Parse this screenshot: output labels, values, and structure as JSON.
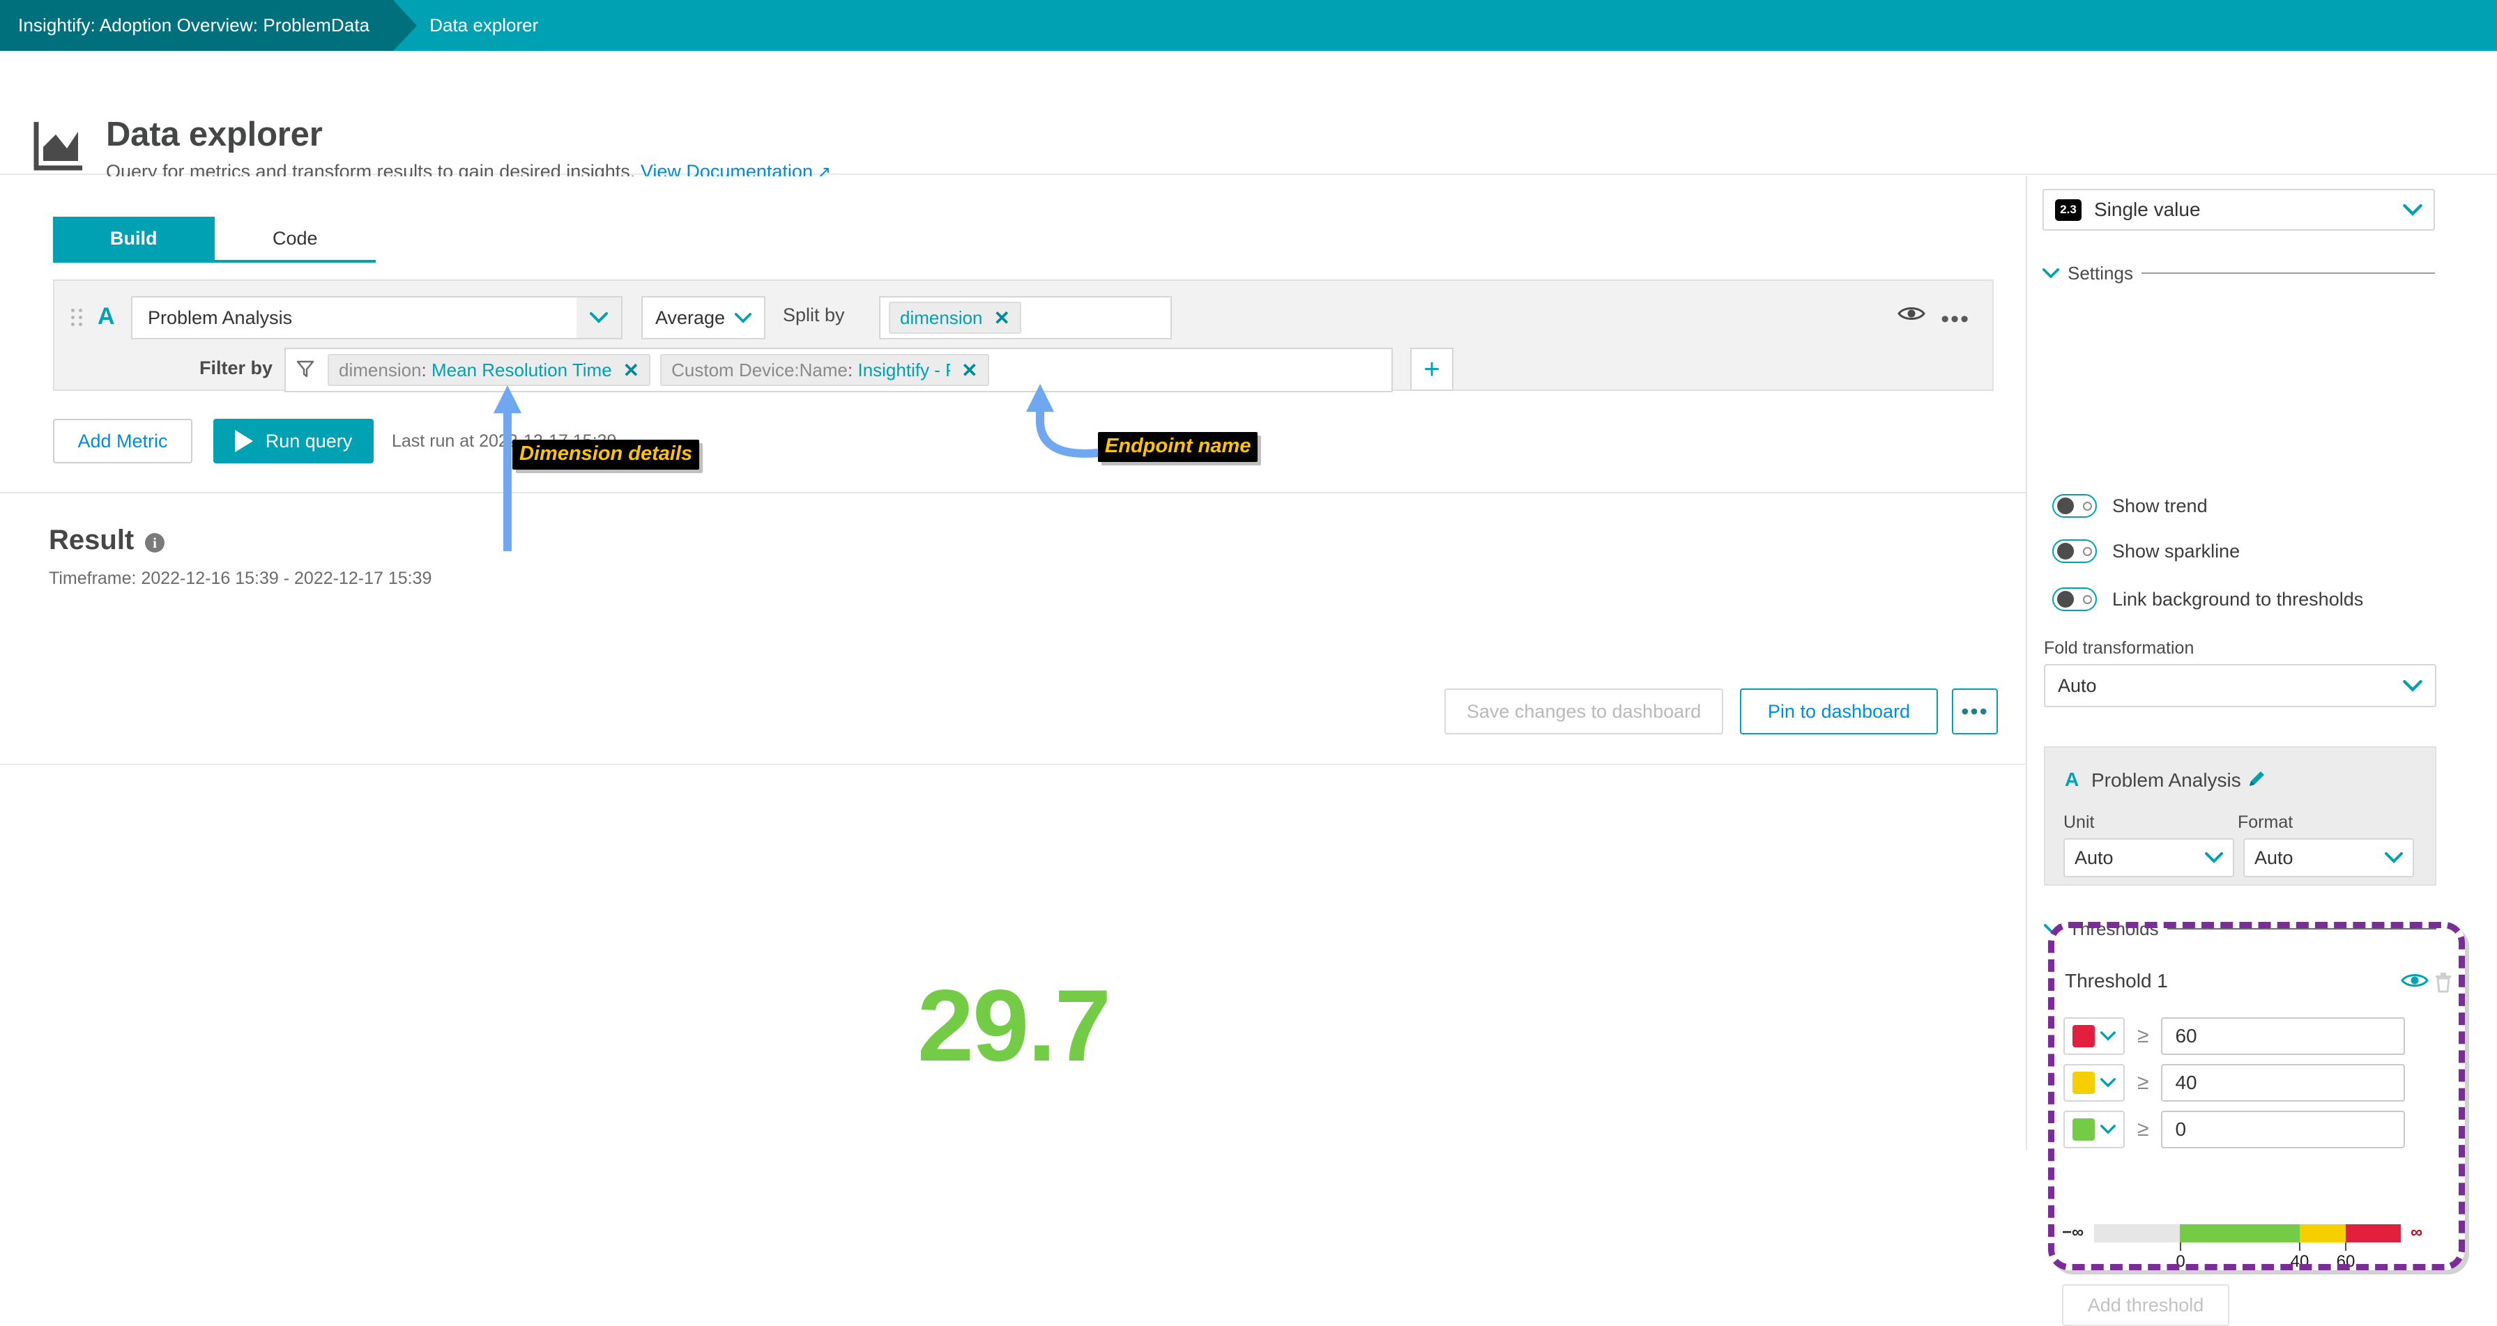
{
  "breadcrumb": {
    "parent": "Insightify: Adoption Overview: ProblemData",
    "current": "Data explorer"
  },
  "header": {
    "title": "Data explorer",
    "subtitle": "Query for metrics and transform results to gain desired insights.",
    "doc_link": "View Documentation",
    "icon": "chart-area-icon"
  },
  "tabs": [
    {
      "label": "Build",
      "active": true
    },
    {
      "label": "Code",
      "active": false
    }
  ],
  "query": {
    "metric_letter": "A",
    "metric_name": "Problem Analysis",
    "aggregation": "Average",
    "split_by_label": "Split by",
    "split_by_chip": "dimension",
    "filter_by_label": "Filter by",
    "filters": [
      {
        "key": "dimension",
        "value": "Mean Resolution Time"
      },
      {
        "key": "Custom Device:Name",
        "value": "Insightify - ProblemData"
      }
    ],
    "add_filter": "+",
    "chip_remove": "✕"
  },
  "actions": {
    "add_metric": "Add Metric",
    "run_query": "Run query",
    "last_run": "Last run at 2022-12-17 15:39."
  },
  "result": {
    "title": "Result",
    "info": "i",
    "timeframe": "Timeframe: 2022-12-16 15:39 - 2022-12-17 15:39",
    "save_changes": "Save changes to dashboard",
    "pin_to_dashboard": "Pin to dashboard",
    "more": "•••",
    "value": "29.7",
    "value_color": "#74cc46"
  },
  "annotations": [
    {
      "id": "dimension-details",
      "text": "Dimension details"
    },
    {
      "id": "endpoint-name",
      "text": "Endpoint name"
    }
  ],
  "panel": {
    "visualization": {
      "badge": "2.3",
      "label": "Single value"
    },
    "settings_label": "Settings",
    "toggles": [
      {
        "label": "Show trend",
        "on": false
      },
      {
        "label": "Show sparkline",
        "on": false
      },
      {
        "label": "Link background to thresholds",
        "on": false
      }
    ],
    "fold": {
      "label": "Fold transformation",
      "value": "Auto"
    },
    "metric": {
      "letter": "A",
      "name": "Problem Analysis",
      "unit_label": "Unit",
      "unit_value": "Auto",
      "format_label": "Format",
      "format_value": "Auto"
    },
    "thresholds": {
      "section_label": "Thresholds",
      "title": "Threshold 1",
      "operator": "≥",
      "rows": [
        {
          "color": "#e2203e",
          "value": "60"
        },
        {
          "color": "#f5cf00",
          "value": "40"
        },
        {
          "color": "#74cc46",
          "value": "0"
        }
      ],
      "scale": {
        "min_label": "−∞",
        "max_label": "∞",
        "ticks": [
          "0",
          "40",
          "60"
        ]
      },
      "add_threshold": "Add threshold"
    }
  },
  "colors": {
    "teal": "#00a1b2",
    "teal_dark": "#00707d",
    "link_blue": "#008cdb",
    "purple_highlight": "#7b2c99",
    "anno_yellow": "#ffc400"
  }
}
